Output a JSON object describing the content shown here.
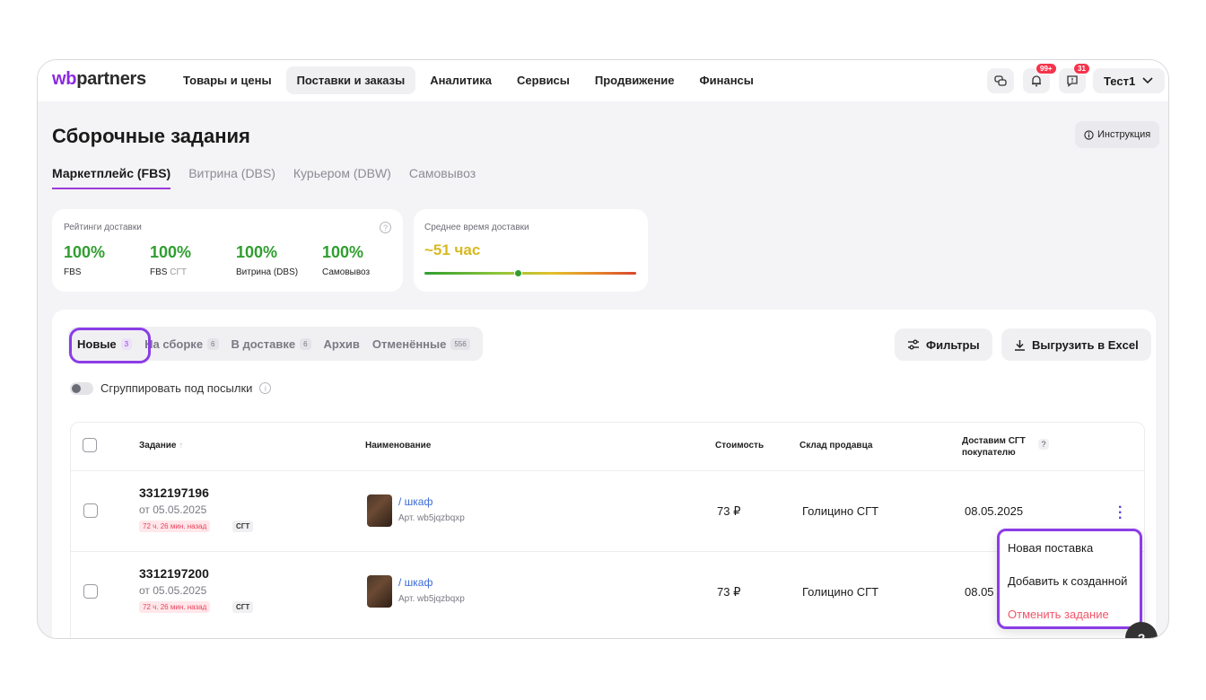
{
  "logo": {
    "part1": "wb",
    "part2": "partners"
  },
  "nav": [
    "Товары и цены",
    "Поставки и заказы",
    "Аналитика",
    "Сервисы",
    "Продвижение",
    "Финансы"
  ],
  "topbar": {
    "notif_badge": "99+",
    "chat_badge": "31",
    "user": "Тест1"
  },
  "page": {
    "title": "Сборочные задания",
    "instruction": "Инструкция"
  },
  "tabs": [
    "Маркетплейс (FBS)",
    "Витрина (DBS)",
    "Курьером (DBW)",
    "Самовывоз"
  ],
  "ratings": {
    "label": "Рейтинги доставки",
    "items": [
      {
        "value": "100%",
        "name": "FBS",
        "suffix": ""
      },
      {
        "value": "100%",
        "name": "FBS",
        "suffix": "СГТ"
      },
      {
        "value": "100%",
        "name": "Витрина (DBS)",
        "suffix": ""
      },
      {
        "value": "100%",
        "name": "Самовывоз",
        "suffix": ""
      }
    ]
  },
  "avg_delivery": {
    "label": "Среднее время доставки",
    "value": "~51 час"
  },
  "status_tabs": [
    {
      "label": "Новые",
      "count": "3"
    },
    {
      "label": "На сборке",
      "count": "6"
    },
    {
      "label": "В доставке",
      "count": "6"
    },
    {
      "label": "Архив",
      "count": ""
    },
    {
      "label": "Отменённые",
      "count": "556"
    }
  ],
  "actions": {
    "filters": "Фильтры",
    "export": "Выгрузить в Excel"
  },
  "group_toggle": "Сгруппировать под посылки",
  "table": {
    "headers": {
      "task": "Задание",
      "name": "Наименование",
      "price": "Стоимость",
      "warehouse": "Склад продавца",
      "delivery_l1": "Доставим СГТ",
      "delivery_l2": "покупателю"
    },
    "rows": [
      {
        "id": "3312197196",
        "date": "от 05.05.2025",
        "ago": "72 ч. 26 мин. назад",
        "tag": "СГТ",
        "name": "/ шкаф",
        "art": "Арт. wb5jqzbqxp",
        "price": "73 ₽",
        "warehouse": "Голицино СГТ",
        "delivery": "08.05.2025"
      },
      {
        "id": "3312197200",
        "date": "от 05.05.2025",
        "ago": "72 ч. 26 мин. назад",
        "tag": "СГТ",
        "name": "/ шкаф",
        "art": "Арт. wb5jqzbqxp",
        "price": "73 ₽",
        "warehouse": "Голицино СГТ",
        "delivery": "08.05"
      }
    ]
  },
  "dropdown": [
    "Новая поставка",
    "Добавить к созданной",
    "Отменить задание"
  ],
  "colors": {
    "accent": "#9d3ad9",
    "highlight": "#8b3ce6",
    "success": "#2f9e2f",
    "danger": "#f0566a",
    "link": "#3b6bd6"
  }
}
